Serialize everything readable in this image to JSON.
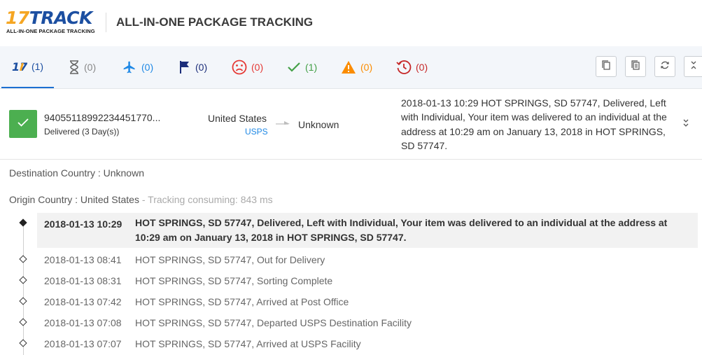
{
  "header": {
    "logo_number": "17",
    "logo_word": "TRACK",
    "logo_tagline": "ALL-IN-ONE PACKAGE TRACKING",
    "title": "ALL-IN-ONE PACKAGE TRACKING"
  },
  "tabs": [
    {
      "name": "all",
      "icon": "17track-logo-icon",
      "count": "(1)"
    },
    {
      "name": "not-found",
      "icon": "hourglass-icon",
      "count": "(0)"
    },
    {
      "name": "in-transit",
      "icon": "airplane-icon",
      "count": "(0)"
    },
    {
      "name": "pick-up",
      "icon": "flag-icon",
      "count": "(0)"
    },
    {
      "name": "undelivered",
      "icon": "sad-face-icon",
      "count": "(0)"
    },
    {
      "name": "delivered",
      "icon": "checkmark-icon",
      "count": "(1)"
    },
    {
      "name": "alert",
      "icon": "warning-triangle-icon",
      "count": "(0)"
    },
    {
      "name": "expired",
      "icon": "history-clock-icon",
      "count": "(0)"
    }
  ],
  "toolbar": {
    "buttons": [
      "copy-icon",
      "copy-all-icon",
      "refresh-icon",
      "collapse-icon"
    ]
  },
  "package": {
    "tracking_number": "94055118992234451770...",
    "status": "Delivered (3 Day(s))",
    "origin_country": "United States",
    "carrier": "USPS",
    "destination_country": "Unknown",
    "latest_event": "2018-01-13 10:29   HOT SPRINGS, SD 57747, Delivered, Left with Individual, Your item was delivered to an individual at the address at 10:29 am on January 13, 2018 in HOT SPRINGS, SD 57747."
  },
  "details": {
    "destination_line": "Destination Country : Unknown",
    "origin_line": "Origin Country : United States",
    "consuming": " - Tracking consuming: 843 ms"
  },
  "events": [
    {
      "datetime": "2018-01-13 10:29",
      "description": "HOT SPRINGS, SD 57747, Delivered, Left with Individual, Your item was delivered to an individual at the address at 10:29 am on January 13, 2018 in HOT SPRINGS, SD 57747."
    },
    {
      "datetime": "2018-01-13 08:41",
      "description": "HOT SPRINGS, SD 57747, Out for Delivery"
    },
    {
      "datetime": "2018-01-13 08:31",
      "description": "HOT SPRINGS, SD 57747, Sorting Complete"
    },
    {
      "datetime": "2018-01-13 07:42",
      "description": "HOT SPRINGS, SD 57747, Arrived at Post Office"
    },
    {
      "datetime": "2018-01-13 07:08",
      "description": "HOT SPRINGS, SD 57747, Departed USPS Destination Facility"
    },
    {
      "datetime": "2018-01-13 07:07",
      "description": "HOT SPRINGS, SD 57747, Arrived at USPS Facility"
    }
  ],
  "colors": {
    "brand_orange": "#f5a623",
    "brand_blue": "#1c4fa1",
    "delivered_green": "#4caf50",
    "link_blue": "#1e88e5"
  }
}
